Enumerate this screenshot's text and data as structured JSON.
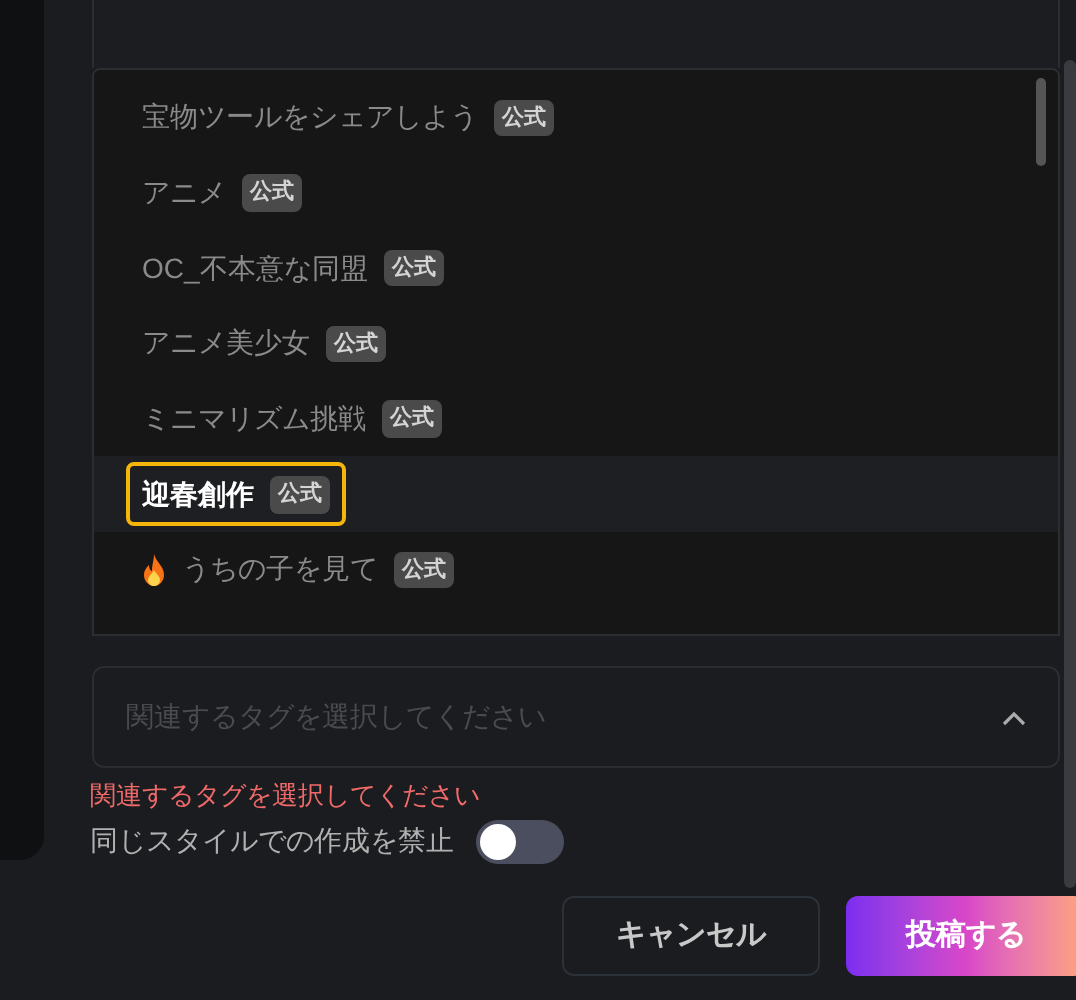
{
  "tag_options": [
    {
      "label": "宝物ツールをシェアしよう",
      "badge": "公式",
      "selected": false,
      "kind": "plain"
    },
    {
      "label": "アニメ",
      "badge": "公式",
      "selected": false,
      "kind": "plain"
    },
    {
      "label": "OC_不本意な同盟",
      "badge": "公式",
      "selected": false,
      "kind": "plain"
    },
    {
      "label": "アニメ美少女",
      "badge": "公式",
      "selected": false,
      "kind": "plain"
    },
    {
      "label": "ミニマリズム挑戦",
      "badge": "公式",
      "selected": false,
      "kind": "plain"
    },
    {
      "label": "迎春創作",
      "badge": "公式",
      "selected": true,
      "kind": "plain"
    },
    {
      "label": "うちの子を見て",
      "badge": "公式",
      "selected": false,
      "kind": "flame"
    }
  ],
  "tag_select": {
    "placeholder": "関連するタグを選択してください",
    "expanded": true
  },
  "error": "関連するタグを選択してください",
  "no_same_style": {
    "label": "同じスタイルでの作成を禁止",
    "on": false
  },
  "buttons": {
    "cancel": "キャンセル",
    "submit": "投稿する"
  }
}
